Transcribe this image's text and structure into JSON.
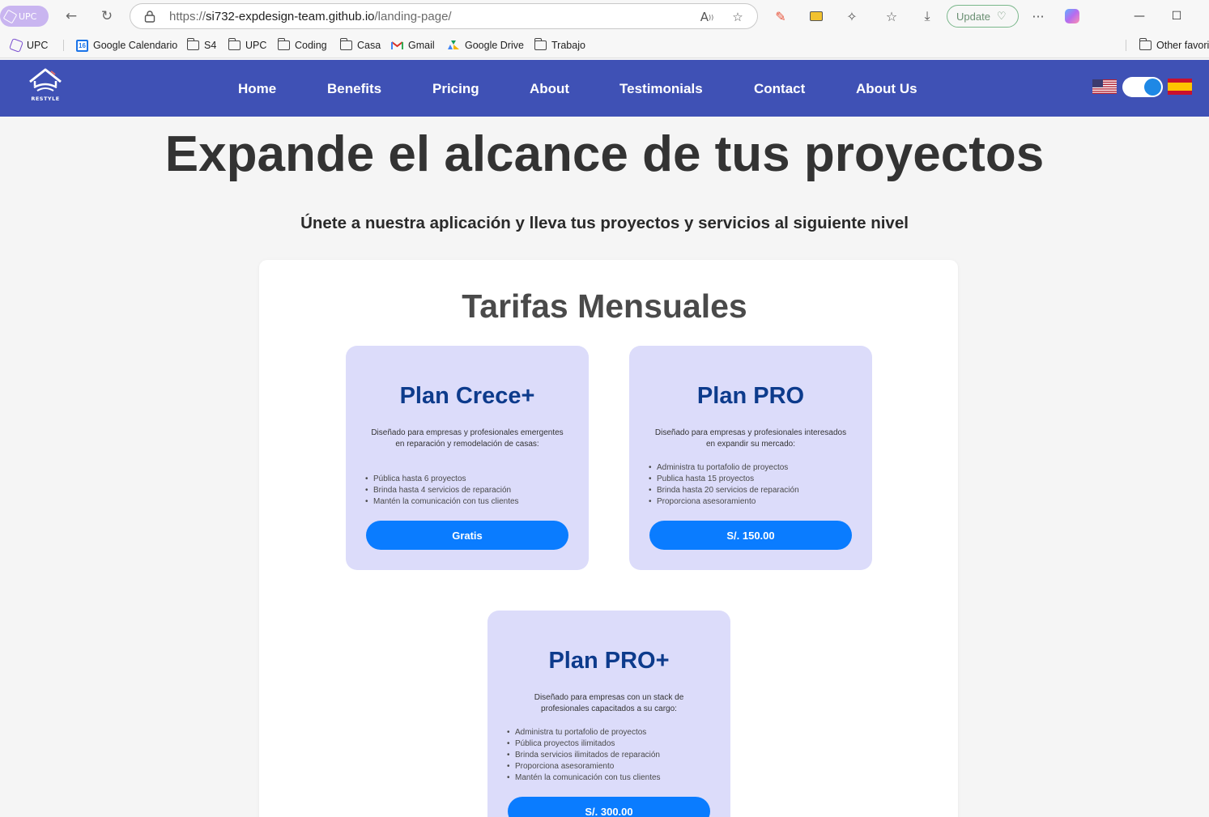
{
  "browser": {
    "profile_label": "UPC",
    "url_prefix": "https://",
    "url_host": "si732-expdesign-team.github.io",
    "url_path": "/landing-page/",
    "update_label": "Update",
    "bookmarks": [
      {
        "label": "UPC",
        "icon": "upc-icon"
      },
      {
        "label": "Google Calendario",
        "icon": "calendar-icon"
      },
      {
        "label": "S4",
        "icon": "folder-icon"
      },
      {
        "label": "UPC",
        "icon": "folder-icon"
      },
      {
        "label": "Coding",
        "icon": "folder-icon"
      },
      {
        "label": "Casa",
        "icon": "folder-icon"
      },
      {
        "label": "Gmail",
        "icon": "gmail-icon"
      },
      {
        "label": "Google Drive",
        "icon": "drive-icon"
      },
      {
        "label": "Trabajo",
        "icon": "folder-icon"
      }
    ],
    "other_favorites": "Other favori",
    "calendar_day": "16"
  },
  "site": {
    "logo_text": "RESTYLE",
    "nav": [
      "Home",
      "Benefits",
      "Pricing",
      "About",
      "Testimonials",
      "Contact",
      "About Us"
    ],
    "language_toggle_on": true
  },
  "hero": {
    "title": "Expande el alcance de tus proyectos",
    "subtitle": "Únete a nuestra aplicación y lleva tus proyectos y servicios al siguiente nivel"
  },
  "pricing": {
    "title": "Tarifas Mensuales",
    "plans": [
      {
        "name": "Plan Crece+",
        "description": "Diseñado para empresas y profesionales emergentes en reparación y remodelación de casas:",
        "features": [
          "Pública hasta 6 proyectos",
          "Brinda hasta 4 servicios de reparación",
          "Mantén la comunicación con tus clientes"
        ],
        "price": "Gratis"
      },
      {
        "name": "Plan PRO",
        "description": "Diseñado para empresas y profesionales interesados en expandir su mercado:",
        "features": [
          "Administra tu portafolio de proyectos",
          "Publica hasta 15 proyectos",
          "Brinda hasta 20 servicios de reparación",
          "Proporciona asesoramiento"
        ],
        "price": "S/. 150.00"
      },
      {
        "name": "Plan PRO+",
        "description": "Diseñado para empresas con un stack de profesionales capacitados a su cargo:",
        "features": [
          "Administra tu portafolio de proyectos",
          "Pública proyectos ilimitados",
          "Brinda servicios ilimitados de reparación",
          "Proporciona asesoramiento",
          "Mantén la comunicación con tus clientes"
        ],
        "price": "S/. 300.00"
      }
    ]
  },
  "colors": {
    "nav_bg": "#3f51b5",
    "card_bg": "#dcdcfa",
    "plan_title": "#0d3b8c",
    "button": "#0a7cff"
  }
}
